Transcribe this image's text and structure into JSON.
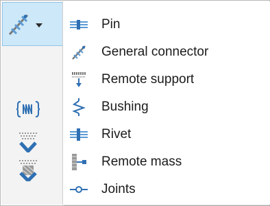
{
  "menu": {
    "items": [
      {
        "label": "Pin",
        "icon": "pin-icon"
      },
      {
        "label": "General connector",
        "icon": "general-connector-icon"
      },
      {
        "label": "Remote support",
        "icon": "remote-support-icon"
      },
      {
        "label": "Bushing",
        "icon": "bushing-icon"
      },
      {
        "label": "Rivet",
        "icon": "rivet-icon"
      },
      {
        "label": "Remote mass",
        "icon": "remote-mass-icon"
      },
      {
        "label": "Joints",
        "icon": "joints-icon"
      }
    ]
  },
  "toolbar": {
    "split_button": {
      "icon": "general-connector-icon",
      "dropdown_icon": "chevron-down-icon"
    },
    "tools": [
      {
        "icon": "spring-bracket-icon"
      },
      {
        "icon": "support-check-icon"
      },
      {
        "icon": "mesh-check-icon"
      }
    ]
  },
  "colors": {
    "selected_bg": "#cde8f8",
    "selected_border": "#8fc4e8",
    "icon_blue": "#2f6fb3",
    "icon_gray": "#6e6e6e"
  }
}
